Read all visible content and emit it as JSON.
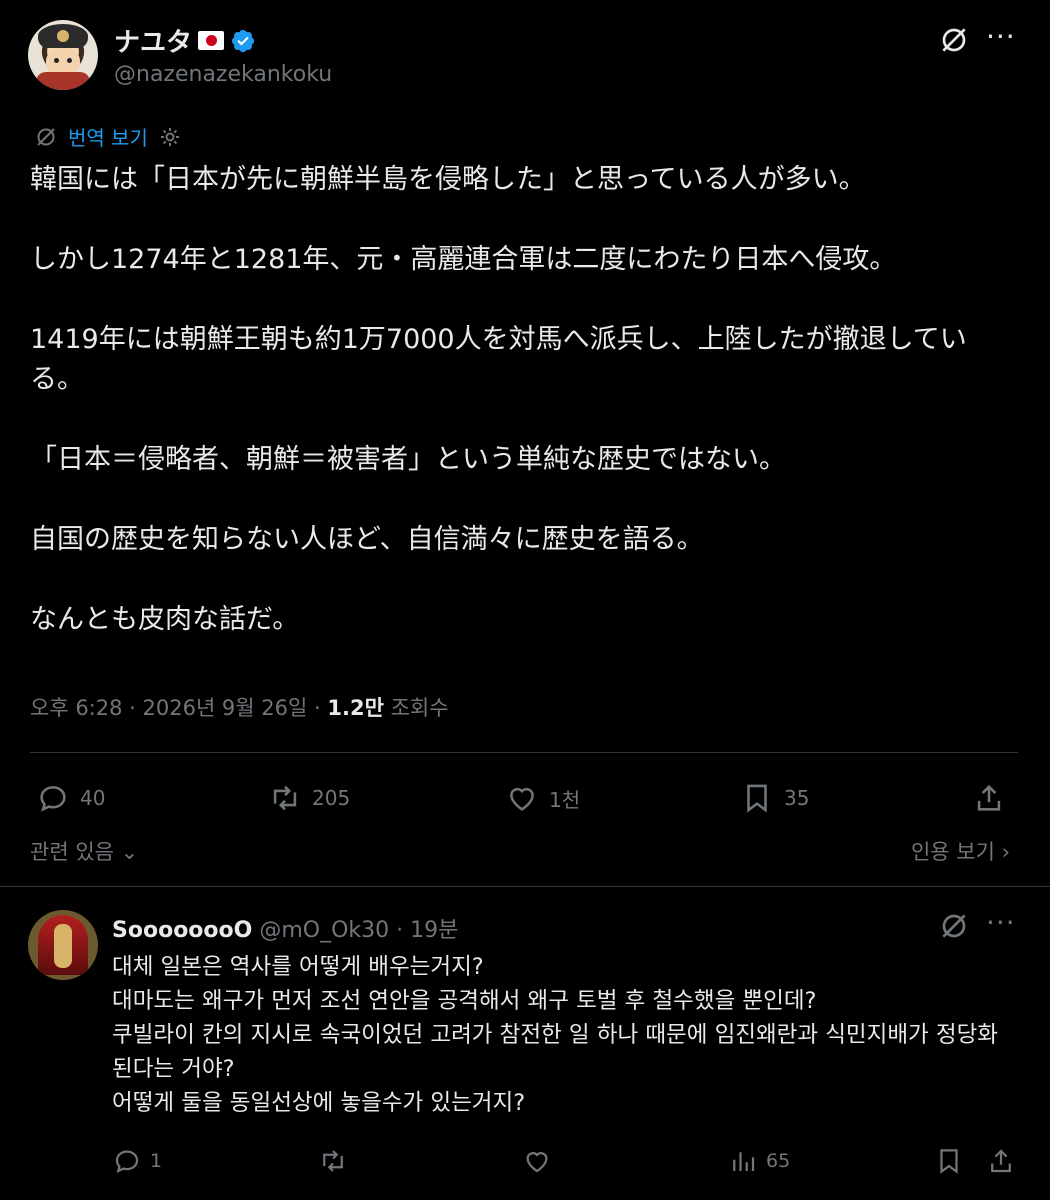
{
  "post": {
    "display_name": "ナユタ",
    "flag_icon": "japan-flag-icon",
    "handle": "@nazenazekankoku",
    "translate_label": "번역 보기",
    "body": "韓国には「日本が先に朝鮮半島を侵略した」と思っている人が多い。\n\nしかし1274年と1281年、元・高麗連合軍は二度にわたり日本へ侵攻。\n\n1419年には朝鮮王朝も約1万7000人を対馬へ派兵し、上陸したが撤退している。\n\n「日本＝侵略者、朝鮮＝被害者」という単純な歴史ではない。\n\n自国の歴史を知らない人ほど、自信満々に歴史を語る。\n\nなんとも皮肉な話だ。",
    "timestamp": "오후 6:28 · 2026년 9월 26일 · ",
    "views_count": "1.2만",
    "views_label": " 조회수",
    "replies": "40",
    "reposts": "205",
    "likes": "1천",
    "bookmarks": "35",
    "related_label": "관련 있음",
    "quote_label": "인용 보기"
  },
  "reply": {
    "display_name": "SoooooooO",
    "handle_time": " @mO_Ok30 · 19분",
    "body": "대체 일본은 역사를 어떻게 배우는거지?\n대마도는 왜구가 먼저 조선 연안을 공격해서 왜구 토벌 후 철수했을 뿐인데?\n쿠빌라이 칸의 지시로 속국이었던 고려가 참전한 일 하나 때문에 임진왜란과 식민지배가 정당화 된다는 거야?\n어떻게 둘을 동일선상에 놓을수가 있는거지?",
    "replies": "1",
    "views": "65"
  },
  "colors": {
    "accent": "#1d9bf0",
    "muted": "#71767b",
    "text": "#e7e9ea",
    "bg": "#000000",
    "divider": "#2f3336"
  }
}
